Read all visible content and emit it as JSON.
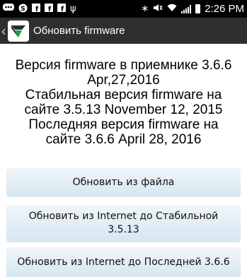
{
  "status_bar": {
    "time": "2:26 PM",
    "icons": [
      "message-icon",
      "skype-icon",
      "facebook-icon",
      "facebook-icon",
      "facebook-icon",
      "usb-icon",
      "bluetooth-icon",
      "mute-icon",
      "wifi-icon",
      "signal-icon",
      "battery-icon"
    ]
  },
  "action_bar": {
    "title": "Обновить firmware"
  },
  "info": {
    "line1": "Версия firmware в приемнике 3.6.6",
    "line2": "Apr,27,2016",
    "line3": "Стабильная версия firmware на",
    "line4": "сайте 3.5.13 November 12, 2015",
    "line5": "Последняя версия firmware на",
    "line6": "сайте 3.6.6 April 28, 2016"
  },
  "buttons": {
    "update_from_file": "Обновить из файла",
    "update_stable_line1": "Обновить из Internet до Стабильной",
    "update_stable_line2": "3.5.13",
    "update_latest": "Обновить из Internet до Последней 3.6.6"
  }
}
